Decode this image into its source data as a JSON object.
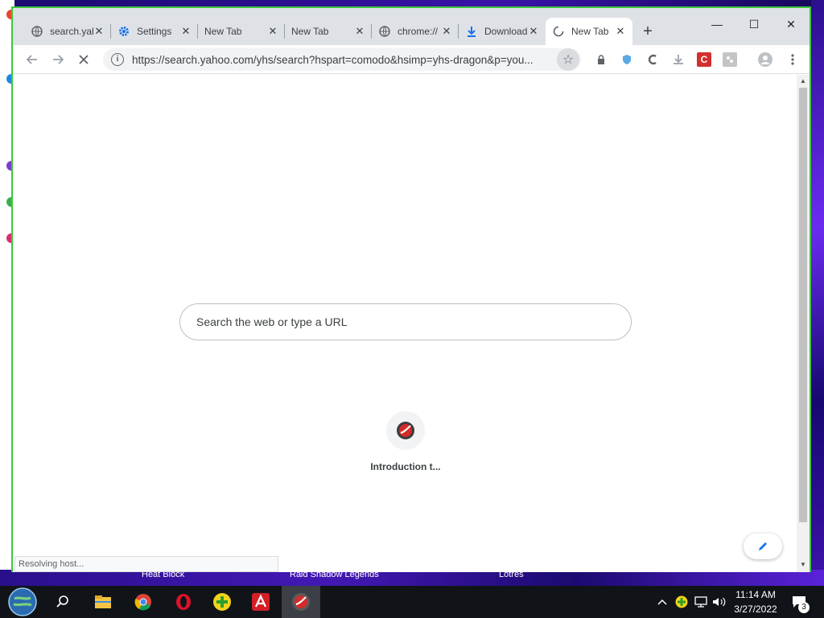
{
  "browser": {
    "tabs": [
      {
        "title": "search.yahoo.com",
        "icon": "globe-icon",
        "active": false
      },
      {
        "title": "Settings",
        "icon": "gear-icon",
        "active": false
      },
      {
        "title": "New Tab",
        "icon": "",
        "active": false
      },
      {
        "title": "New Tab",
        "icon": "",
        "active": false
      },
      {
        "title": "chrome://",
        "icon": "globe-icon",
        "active": false
      },
      {
        "title": "Downloads",
        "icon": "download-icon",
        "active": false
      },
      {
        "title": "New Tab",
        "icon": "loading-spinner-icon",
        "active": true
      }
    ],
    "tab_close_glyph": "✕",
    "new_tab_glyph": "+",
    "window_controls": {
      "minimize": "—",
      "maximize": "☐",
      "close": "✕"
    },
    "address_bar": {
      "url": "https://search.yahoo.com/yhs/search?hspart=comodo&hsimp=yhs-dragon&p=you..."
    },
    "extensions": [
      "lock-icon",
      "shield-icon",
      "c-icon",
      "download-ext-icon",
      "red-c-icon",
      "puzzle-icon",
      "profile-icon",
      "menu-icon"
    ]
  },
  "content": {
    "search_placeholder": "Search the web or type a URL",
    "shortcut_tile": {
      "label": "Introduction t...",
      "icon": "comodo-dragon-icon"
    },
    "status_text": "Resolving host..."
  },
  "desktop": {
    "bottom_labels": [
      "Heat Block",
      "Raid Shadow Legends",
      "Lotres"
    ]
  },
  "taskbar": {
    "apps": [
      "start-globe-icon",
      "search-icon",
      "file-explorer-icon",
      "chrome-icon",
      "opera-icon",
      "plus-icon",
      "avira-icon",
      "comodo-dragon-icon"
    ],
    "clock_time": "11:14 AM",
    "clock_date": "3/27/2022",
    "notification_count": "3"
  },
  "colors": {
    "window_border": "#3ec73e",
    "tabstrip_bg": "#dee1e6",
    "taskbar_bg": "#101418"
  }
}
